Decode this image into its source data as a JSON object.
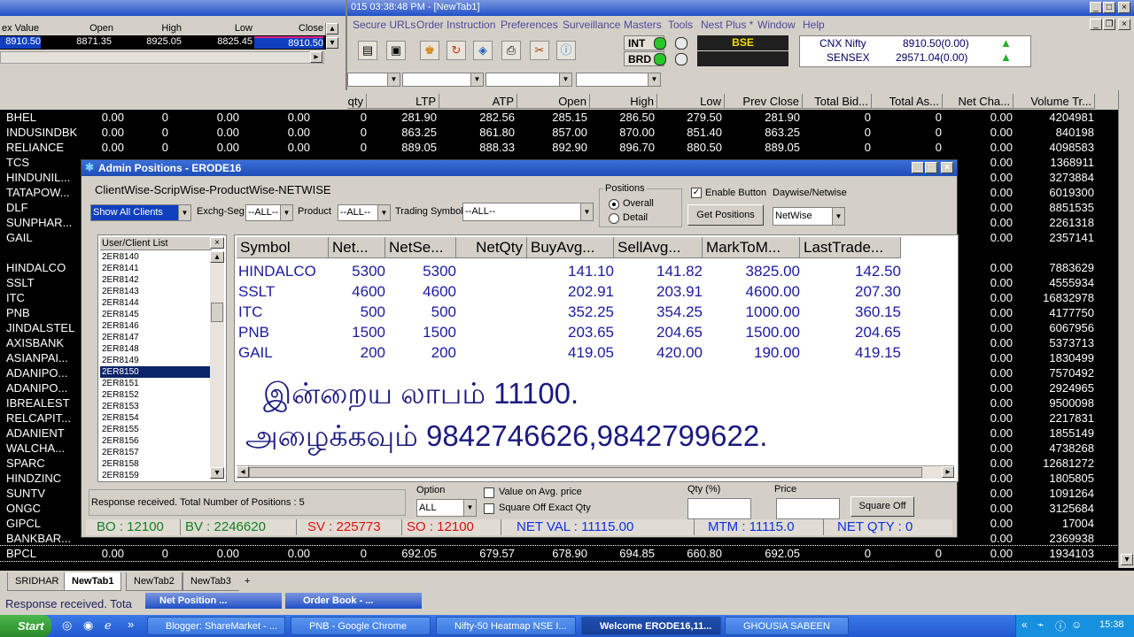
{
  "main_window": {
    "title": "015  03:38:48 PM - [NewTab1]",
    "menu": [
      "Secure URLs",
      "Order Instruction",
      "Preferences",
      "Surveillance",
      "Masters",
      "Tools",
      "Nest Plus *",
      "Window",
      "Help"
    ],
    "int_label": "INT",
    "brd_label": "BRD",
    "exchange_label": "BSE",
    "index_rows": [
      {
        "name": "CNX Nifty",
        "value": "8910.50(0.00)"
      },
      {
        "name": "SENSEX",
        "value": "29571.04(0.00)"
      }
    ]
  },
  "mini_window": {
    "headers": [
      "ex Value",
      "Open",
      "High",
      "Low",
      "Close"
    ],
    "values": [
      "8910.50",
      "8871.35",
      "8925.05",
      "8825.45",
      "8910.50"
    ]
  },
  "market_watch": {
    "headers": [
      "qty",
      "LTP",
      "ATP",
      "Open",
      "High",
      "Low",
      "Prev Close",
      "Total Bid...",
      "Total As...",
      "Net Cha...",
      "Volume Tr..."
    ],
    "rows": [
      {
        "sym": "BHEL",
        "a": "0.00",
        "b": "0",
        "c": "0.00",
        "d": "0.00",
        "e": "0",
        "ltp": "281.90",
        "atp": "282.56",
        "open": "285.15",
        "high": "286.50",
        "low": "279.50",
        "prev": "281.90",
        "tb": "0",
        "ta": "0",
        "nc": "0.00",
        "vol": "4204981"
      },
      {
        "sym": "INDUSINDBK",
        "a": "0.00",
        "b": "0",
        "c": "0.00",
        "d": "0.00",
        "e": "0",
        "ltp": "863.25",
        "atp": "861.80",
        "open": "857.00",
        "high": "870.00",
        "low": "851.40",
        "prev": "863.25",
        "tb": "0",
        "ta": "0",
        "nc": "0.00",
        "vol": "840198"
      },
      {
        "sym": "RELIANCE",
        "a": "0.00",
        "b": "0",
        "c": "0.00",
        "d": "0.00",
        "e": "0",
        "ltp": "889.05",
        "atp": "888.33",
        "open": "892.90",
        "high": "896.70",
        "low": "880.50",
        "prev": "889.05",
        "tb": "0",
        "ta": "0",
        "nc": "0.00",
        "vol": "4098583"
      },
      {
        "sym": "TCS",
        "nc": "0.00",
        "vol": "1368911"
      },
      {
        "sym": "HINDUNIL...",
        "nc": "0.00",
        "vol": "3273884"
      },
      {
        "sym": "TATAPOW...",
        "nc": "0.00",
        "vol": "6019300"
      },
      {
        "sym": "DLF",
        "nc": "0.00",
        "vol": "8851535"
      },
      {
        "sym": "SUNPHAR...",
        "nc": "0.00",
        "vol": "2261318"
      },
      {
        "sym": "GAIL",
        "nc": "0.00",
        "vol": "2357141"
      },
      {
        "sym": "",
        "nc": "",
        "vol": ""
      },
      {
        "sym": "HINDALCO",
        "nc": "0.00",
        "vol": "7883629"
      },
      {
        "sym": "SSLT",
        "nc": "0.00",
        "vol": "4555934"
      },
      {
        "sym": "ITC",
        "nc": "0.00",
        "vol": "16832978"
      },
      {
        "sym": "PNB",
        "nc": "0.00",
        "vol": "4177750"
      },
      {
        "sym": "JINDALSTEL",
        "nc": "0.00",
        "vol": "6067956"
      },
      {
        "sym": "AXISBANK",
        "nc": "0.00",
        "vol": "5373713"
      },
      {
        "sym": "ASIANPAI...",
        "nc": "0.00",
        "vol": "1830499"
      },
      {
        "sym": "ADANIPO...",
        "nc": "0.00",
        "vol": "7570492"
      },
      {
        "sym": "ADANIPO...",
        "nc": "0.00",
        "vol": "2924965"
      },
      {
        "sym": "IBREALEST",
        "nc": "0.00",
        "vol": "9500098"
      },
      {
        "sym": "RELCAPIT...",
        "nc": "0.00",
        "vol": "2217831"
      },
      {
        "sym": "ADANIENT",
        "nc": "0.00",
        "vol": "1855149"
      },
      {
        "sym": "WALCHA...",
        "nc": "0.00",
        "vol": "4738268"
      },
      {
        "sym": "SPARC",
        "nc": "0.00",
        "vol": "12681272"
      },
      {
        "sym": "HINDZINC",
        "nc": "0.00",
        "vol": "1805805"
      },
      {
        "sym": "SUNTV",
        "nc": "0.00",
        "vol": "1091264"
      },
      {
        "sym": "ONGC",
        "nc": "0.00",
        "vol": "3125684"
      },
      {
        "sym": "GIPCL",
        "nc": "0.00",
        "vol": "17004"
      },
      {
        "sym": "BANKBAR...",
        "nc": "0.00",
        "vol": "2369938"
      },
      {
        "sym": "BPCL",
        "a": "0.00",
        "b": "0",
        "c": "0.00",
        "d": "0.00",
        "e": "0",
        "ltp": "692.05",
        "atp": "679.57",
        "open": "678.90",
        "high": "694.85",
        "low": "660.80",
        "prev": "692.05",
        "tb": "0",
        "ta": "0",
        "nc": "0.00",
        "vol": "1934103"
      }
    ]
  },
  "dialog": {
    "title": "Admin Positions - ERODE16",
    "subtitle": "ClientWise-ScripWise-ProductWise-NETWISE",
    "client_select": "Show All Clients",
    "exchg_label": "Exchg-Seg",
    "exchg_value": "--ALL--",
    "product_label": "Product",
    "product_value": "--ALL--",
    "symbol_label": "Trading Symbol",
    "symbol_value": "--ALL--",
    "positions_label": "Positions",
    "overall_label": "Overall",
    "detail_label": "Detail",
    "enable_button_label": "Enable Button",
    "daywise_label": "Daywise/Netwise",
    "get_positions": "Get Positions",
    "netwise_value": "NetWise",
    "list_header": "User/Client List",
    "clients": [
      "2ER8140",
      "2ER8141",
      "2ER8142",
      "2ER8143",
      "2ER8144",
      "2ER8145",
      "2ER8146",
      "2ER8147",
      "2ER8148",
      "2ER8149",
      "2ER8150",
      "2ER8151",
      "2ER8152",
      "2ER8153",
      "2ER8154",
      "2ER8155",
      "2ER8156",
      "2ER8157",
      "2ER8158",
      "2ER8159"
    ],
    "selected_client": "2ER8150",
    "grid_headers": [
      "Symbol",
      "Net...",
      "NetSe...",
      "NetQty",
      "BuyAvg...",
      "SellAvg...",
      "MarkToM...",
      "LastTrade..."
    ],
    "grid_rows": [
      [
        "HINDALCO",
        "5300",
        "5300",
        "",
        "141.10",
        "141.82",
        "3825.00",
        "142.50"
      ],
      [
        "SSLT",
        "4600",
        "4600",
        "",
        "202.91",
        "203.91",
        "4600.00",
        "207.30"
      ],
      [
        "ITC",
        "500",
        "500",
        "",
        "352.25",
        "354.25",
        "1000.00",
        "360.15"
      ],
      [
        "PNB",
        "1500",
        "1500",
        "",
        "203.65",
        "204.65",
        "1500.00",
        "204.65"
      ],
      [
        "GAIL",
        "200",
        "200",
        "",
        "419.05",
        "420.00",
        "190.00",
        "419.15"
      ]
    ],
    "tamil_line1": "இன்றைய லாபம் 11100.",
    "tamil_line2": "அழைக்கவும் 9842746626,9842799622.",
    "response_text": "Response received. Total Number of Positions : 5",
    "option_label": "Option",
    "option_value": "ALL",
    "value_on_avg": "Value on Avg. price",
    "square_off_exact": "Square Off Exact Qty",
    "qty_label": "Qty (%)",
    "price_label": "Price",
    "square_off_button": "Square Off",
    "status": {
      "bo": "BO : 12100",
      "bv": "BV : 2246620",
      "sv": "SV : 225773",
      "so": "SO : 12100",
      "net_val": "NET VAL : 11115.00",
      "mtm": "MTM : 11115.0",
      "net_qty": "NET QTY : 0"
    }
  },
  "tabs": [
    "SRIDHAR",
    "NewTab1",
    "NewTab2",
    "NewTab3",
    "+"
  ],
  "bottom_status": "Response received. Tota",
  "minimized": [
    "Net Position ...",
    "Order Book - ..."
  ],
  "taskbar": {
    "start": "Start",
    "tasks": [
      "Blogger: ShareMarket - ...",
      "PNB - Google Chrome",
      "Nifty-50 Heatmap NSE I...",
      "Welcome ERODE16,11...",
      "GHOUSIA SABEEN"
    ],
    "clock": "15:38"
  }
}
